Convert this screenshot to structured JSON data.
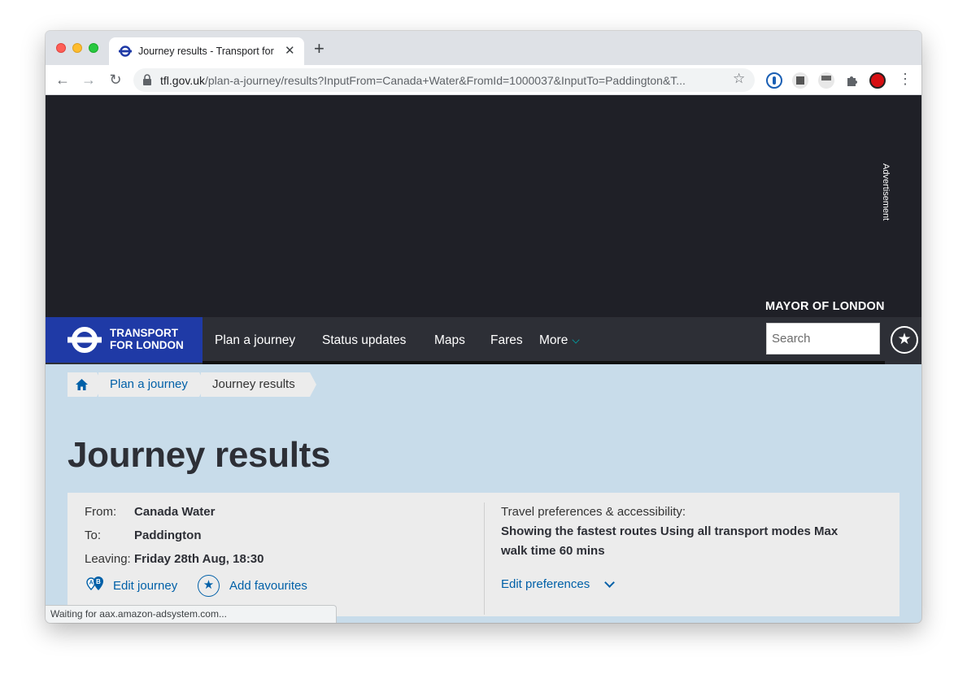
{
  "browser": {
    "tab_title": "Journey results - Transport for",
    "tab_close": "✕",
    "new_tab": "+",
    "url_host": "tfl.gov.uk",
    "url_path": "/plan-a-journey/results?InputFrom=Canada+Water&FromId=1000037&InputTo=Paddington&T...",
    "back": "←",
    "forward": "→",
    "reload": "↻",
    "bookmark": "☆",
    "menu": "⋮",
    "status": "Waiting for aax.amazon-adsystem.com..."
  },
  "ad": {
    "label": "Advertisement",
    "mayor": "MAYOR OF LONDON"
  },
  "nav": {
    "brand_line1": "TRANSPORT",
    "brand_line2": "FOR LONDON",
    "links": [
      "Plan a journey",
      "Status updates",
      "Maps",
      "Fares",
      "More"
    ],
    "search_placeholder": "Search",
    "fav_star": "★"
  },
  "breadcrumb": {
    "plan": "Plan a journey",
    "current": "Journey results"
  },
  "page": {
    "title": "Journey results"
  },
  "journey": {
    "from_label": "From:",
    "from_value": "Canada Water",
    "to_label": "To:",
    "to_value": "Paddington",
    "leaving_label": "Leaving:",
    "leaving_value": "Friday 28th Aug, 18:30",
    "edit_journey": "Edit journey",
    "add_favourites": "Add favourites",
    "fav_star": "★"
  },
  "preferences": {
    "title": "Travel preferences & accessibility:",
    "line1": "Showing the fastest routes Using all transport modes Max",
    "line2": "walk time 60 mins",
    "edit": "Edit preferences"
  },
  "colors": {
    "tfl_blue": "#1f3aa6",
    "link_blue": "#0060a8",
    "nav_dark": "#2d2f36",
    "page_bg": "#c8dcea"
  }
}
